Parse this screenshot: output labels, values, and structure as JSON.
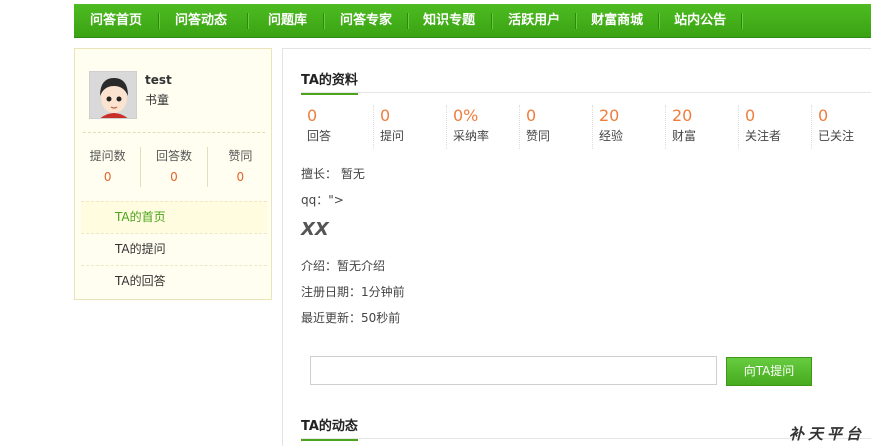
{
  "nav": {
    "items": [
      "问答首页",
      "问答动态",
      "问题库",
      "问答专家",
      "知识专题",
      "活跃用户",
      "财富商城",
      "站内公告"
    ]
  },
  "profile": {
    "name": "test",
    "level": "书童",
    "stats": [
      {
        "label": "提问数",
        "value": "0"
      },
      {
        "label": "回答数",
        "value": "0"
      },
      {
        "label": "赞同",
        "value": "0"
      }
    ],
    "menu": [
      "TA的首页",
      "TA的提问",
      "TA的回答"
    ]
  },
  "main": {
    "info_title": "TA的资料",
    "stats": [
      {
        "value": "0",
        "label": "回答"
      },
      {
        "value": "0",
        "label": "提问"
      },
      {
        "value": "0%",
        "label": "采纳率"
      },
      {
        "value": "0",
        "label": "赞同"
      },
      {
        "value": "20",
        "label": "经验"
      },
      {
        "value": "20",
        "label": "财富"
      },
      {
        "value": "0",
        "label": "关注者"
      },
      {
        "value": "0",
        "label": "已关注"
      }
    ],
    "specialty": "擅长： 暂无",
    "qq": "qq：\">",
    "xx": "XX",
    "intro": "介绍：暂无介绍",
    "reg_date": "注册日期：1分钟前",
    "last_update": "最近更新：50秒前",
    "ask_input_value": "",
    "ask_button": "向TA提问",
    "activity_title": "TA的动态"
  },
  "watermark": "补天平台",
  "colors": {
    "accent": "#4aa41c",
    "stat_orange": "#f07d3c",
    "nav_green": "#45b11a"
  }
}
